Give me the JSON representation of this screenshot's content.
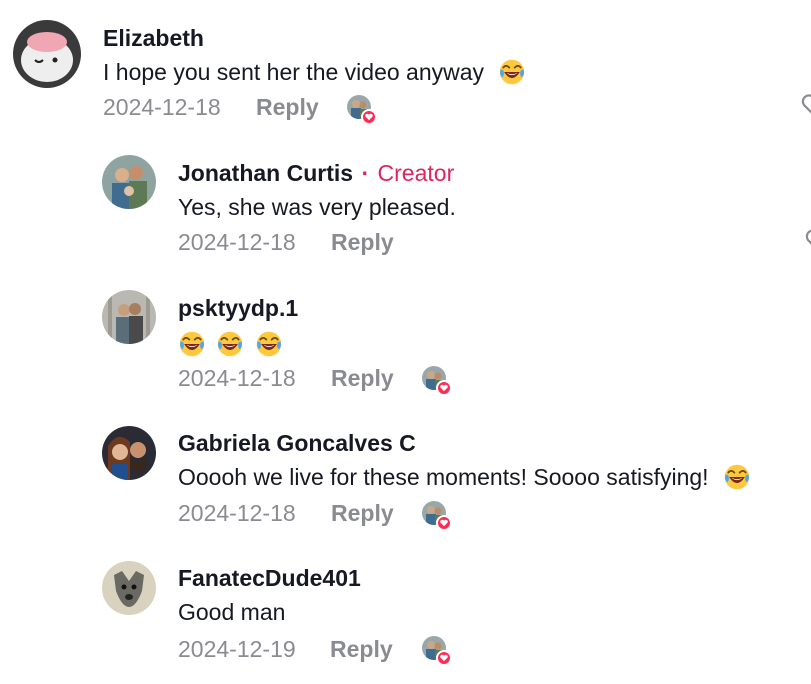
{
  "comments": [
    {
      "username": "Elizabeth",
      "text": "I hope you sent her the video anyway",
      "date": "2024-12-18",
      "reply_label": "Reply"
    },
    {
      "username": "Jonathan Curtis",
      "creator_sep": "·",
      "creator_label": "Creator",
      "text": "Yes, she was very pleased.",
      "date": "2024-12-18",
      "reply_label": "Reply"
    },
    {
      "username": "psktyydp.1",
      "text": "",
      "date": "2024-12-18",
      "reply_label": "Reply"
    },
    {
      "username": "Gabriela Goncalves C",
      "text": "Ooooh we live for these moments! Soooo satisfying!",
      "date": "2024-12-18",
      "reply_label": "Reply"
    },
    {
      "username": "FanatecDude401",
      "text": "Good man",
      "date": "2024-12-19",
      "reply_label": "Reply"
    }
  ],
  "colors": {
    "creator_accent": "#e0245e",
    "heart": "#fe2c55",
    "meta": "#8a8b91",
    "text": "#161823"
  },
  "icons": {
    "laughing_emoji": "face-with-tears-of-joy",
    "liked_by_creator": "creator-heart-badge",
    "like_button": "heart-outline-icon"
  }
}
